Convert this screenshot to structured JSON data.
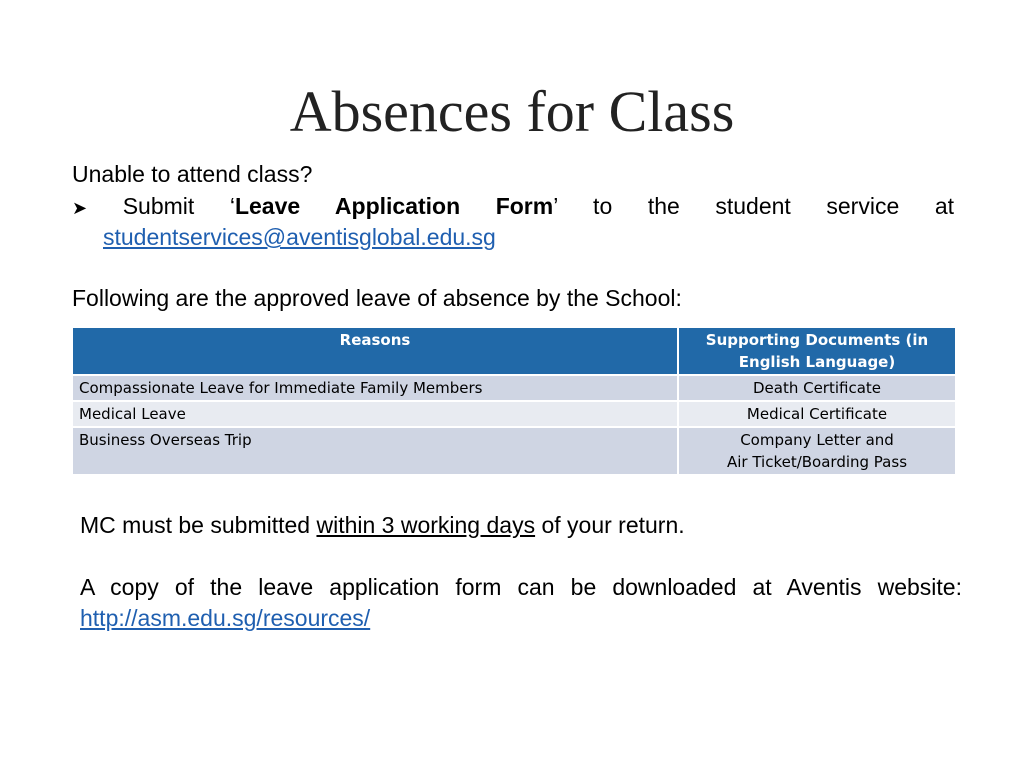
{
  "title": "Absences for Class",
  "intro": "Unable to attend class?",
  "bullet": {
    "icon": "arrow-bullet-icon",
    "prefix": "Submit ‘",
    "bold": "Leave Application Form",
    "suffix": "’ to the student service at",
    "email": "studentservices@aventisglobal.edu.sg"
  },
  "following": "Following are the approved leave of absence by the School:",
  "table": {
    "headers": [
      "Reasons",
      "Supporting Documents (in English Language)"
    ],
    "rows": [
      [
        "Compassionate Leave for Immediate Family Members",
        "Death Certificate"
      ],
      [
        "Medical Leave",
        "Medical Certificate"
      ],
      [
        "Business Overseas Trip",
        "Company Letter and",
        "Air Ticket/Boarding Pass"
      ]
    ],
    "colors": {
      "header": "#2169a8",
      "row_dark": "#cfd5e3",
      "row_light": "#e8ebf1"
    }
  },
  "mc": {
    "pre": "MC must be submitted ",
    "underlined": "within 3 working days",
    "post": " of your return."
  },
  "copy": {
    "text": "A copy of the leave application form can be downloaded at Aventis website:",
    "url": "http://asm.edu.sg/resources/"
  }
}
